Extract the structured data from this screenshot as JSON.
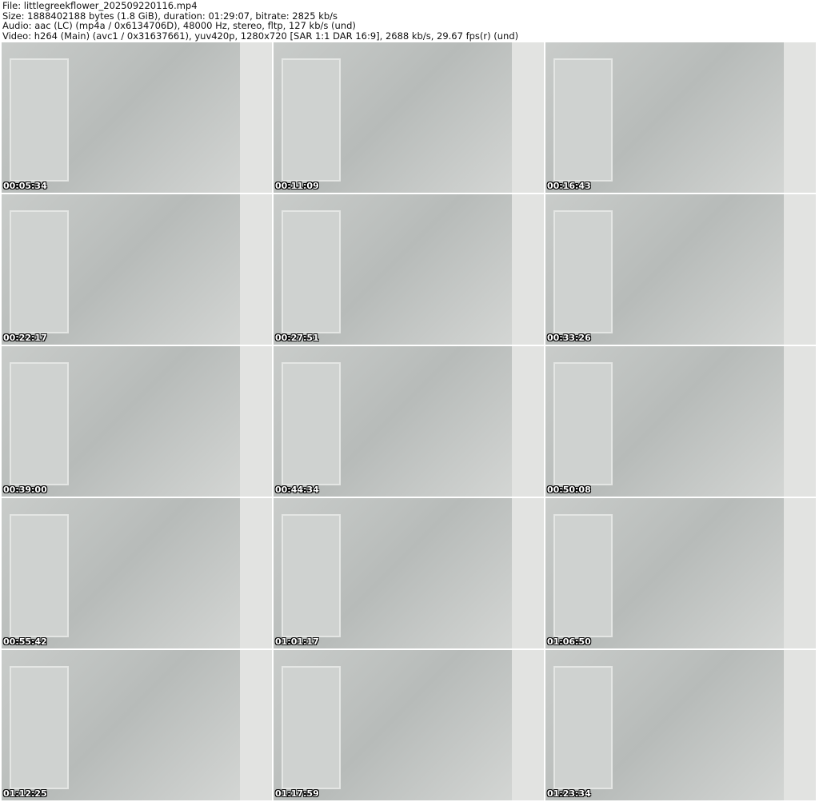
{
  "header": {
    "file": "File: littlegreekflower_202509220116.mp4",
    "size": "Size: 1888402188 bytes (1.8 GiB), duration: 01:29:07, bitrate: 2825 kb/s",
    "audio": "Audio: aac (LC) (mp4a / 0x6134706D), 48000 Hz, stereo, fltp, 127 kb/s (und)",
    "video": "Video: h264 (Main) (avc1 / 0x31637661), yuv420p, 1280x720 [SAR 1:1 DAR 16:9], 2688 kb/s, 29.67 fps(r) (und)"
  },
  "thumbnails": [
    "00:05:34",
    "00:11:09",
    "00:16:43",
    "00:22:17",
    "00:27:51",
    "00:33:26",
    "00:39:00",
    "00:44:34",
    "00:50:08",
    "00:55:42",
    "01:01:17",
    "01:06:50",
    "01:12:25",
    "01:17:59",
    "01:23:34"
  ]
}
